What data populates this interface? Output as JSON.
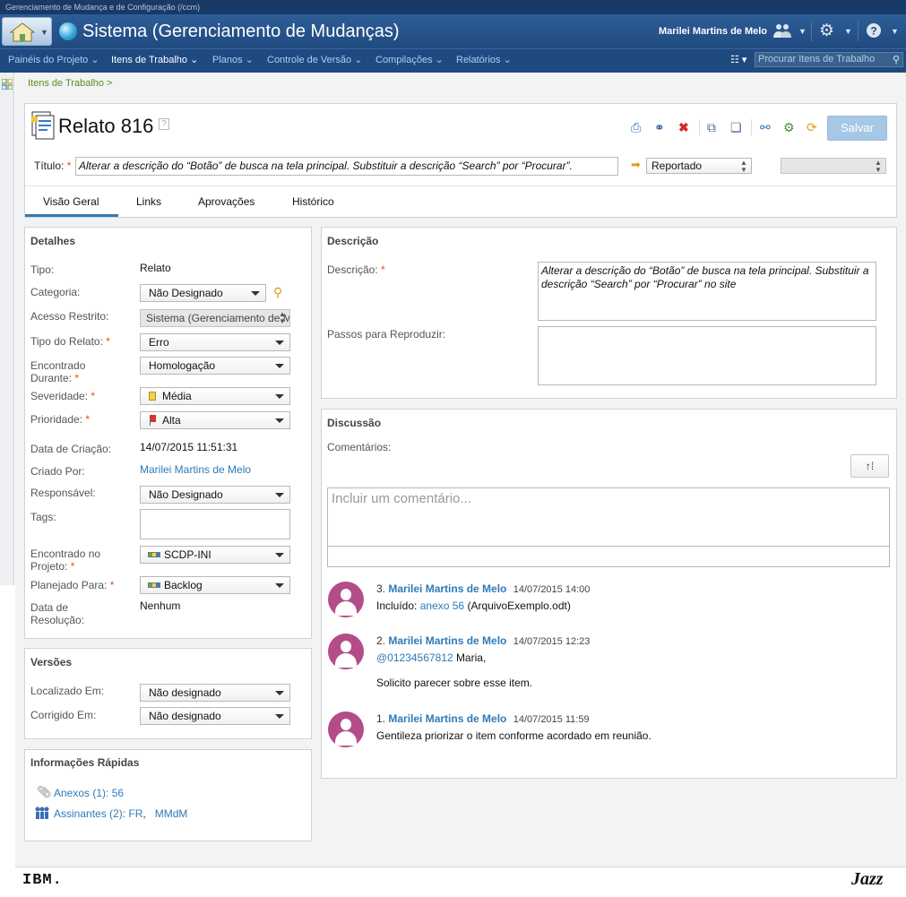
{
  "window": {
    "title": "Gerenciamento de Mudança e de Configuração (/ccm)"
  },
  "header": {
    "app_title": "Sistema (Gerenciamento de Mudanças)",
    "user": "Marilei Martins de Melo"
  },
  "nav": {
    "items": [
      "Painéis do Projeto",
      "Itens de Trabalho",
      "Planos",
      "Controle de Versão",
      "Compilações",
      "Relatórios"
    ],
    "search_placeholder": "Procurar Itens de Trabalho"
  },
  "breadcrumb": "Itens de Trabalho >",
  "workitem": {
    "heading": "Relato 816",
    "help": "?",
    "save_label": "Salvar",
    "title_label": "Título:",
    "title_value": "Alterar a descrição do “Botão” de busca na tela principal. Substituir a descrição “Search” por “Procurar”.",
    "state": "Reportado"
  },
  "tabs": [
    "Visão Geral",
    "Links",
    "Aprovações",
    "Histórico"
  ],
  "details": {
    "title": "Detalhes",
    "tipo_label": "Tipo:",
    "tipo": "Relato",
    "categoria_label": "Categoria:",
    "categoria": "Não Designado",
    "acesso_label": "Acesso Restrito:",
    "acesso": "Sistema (Gerenciamento de Mudanças)",
    "tipo_relato_label": "Tipo do Relato:",
    "tipo_relato": "Erro",
    "encontrado_label_1": "Encontrado",
    "encontrado_label_2": "Durante:",
    "encontrado": "Homologação",
    "severidade_label": "Severidade:",
    "severidade": "Média",
    "prioridade_label": "Prioridade:",
    "prioridade": "Alta",
    "data_criacao_label": "Data de Criação:",
    "data_criacao": "14/07/2015 11:51:31",
    "criado_por_label": "Criado Por:",
    "criado_por": "Marilei Martins de Melo",
    "responsavel_label": "Responsável:",
    "responsavel": "Não Designado",
    "tags_label": "Tags:",
    "projeto_label_1": "Encontrado no",
    "projeto_label_2": "Projeto:",
    "projeto": "SCDP-INI",
    "planejado_label": "Planejado Para:",
    "planejado": "Backlog",
    "resolucao_label_1": "Data de",
    "resolucao_label_2": "Resolução:",
    "resolucao": "Nenhum"
  },
  "versions": {
    "title": "Versões",
    "localizado_label": "Localizado Em:",
    "localizado": "Não designado",
    "corrigido_label": "Corrigido Em:",
    "corrigido": "Não designado"
  },
  "quick_info": {
    "title": "Informações Rápidas",
    "anexos_label": "Anexos (1):",
    "anexos_value": "56",
    "assinantes_label": "Assinantes (2):",
    "assinante_1": "FR",
    "assinante_2": "MMdM"
  },
  "description": {
    "title": "Descrição",
    "label": "Descrição:",
    "text": "Alterar a descrição do “Botão” de busca na tela principal. Substituir a descrição “Search” por “Procurar” no site",
    "steps_label": "Passos para Reproduzir:"
  },
  "discussion": {
    "title": "Discussão",
    "comments_label": "Comentários:",
    "comment_placeholder": "Incluir um comentário...",
    "comments": [
      {
        "num": "3.",
        "author": "Marilei Martins de Melo",
        "date": "14/07/2015 14:00",
        "prefix": "Incluído:",
        "link": "anexo 56",
        "suffix": "(ArquivoExemplo.odt)"
      },
      {
        "num": "2.",
        "author": "Marilei Martins de Melo",
        "date": "14/07/2015 12:23",
        "mention": "@01234567812",
        "line1_rest": "Maria,",
        "line2": "Solicito parecer sobre esse item."
      },
      {
        "num": "1.",
        "author": "Marilei Martins de Melo",
        "date": "14/07/2015 11:59",
        "text": "Gentileza priorizar o item conforme acordado em reunião."
      }
    ]
  },
  "footer": {
    "left_logo": "IBM.",
    "right_logo": "Jazz"
  },
  "colors": {
    "header": "#1f4a80",
    "link": "#2e7ab8",
    "accent_tab": "#2e7ab8",
    "required": "#e05016",
    "avatar": "#b44c8a",
    "save_button": "#a7c7e6"
  }
}
